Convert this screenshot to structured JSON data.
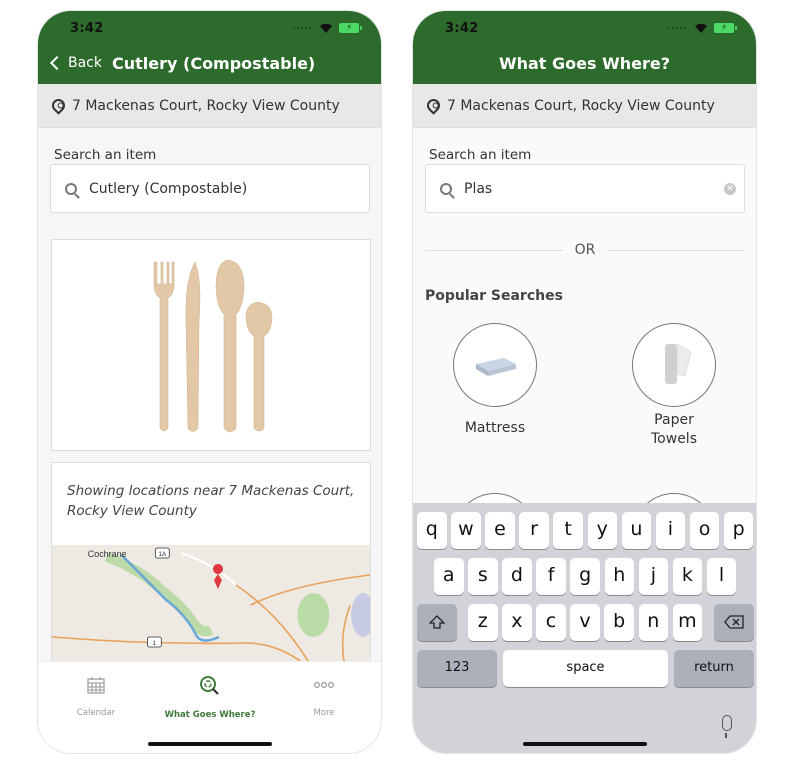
{
  "status_bar": {
    "time": "3:42"
  },
  "left_screen": {
    "nav": {
      "back_label": "Back",
      "title": "Cutlery (Compostable)"
    },
    "address": "7 Mackenas Court, Rocky View County",
    "search": {
      "label": "Search an item",
      "value": "Cutlery (Compostable)"
    },
    "item_image": "compostable-cutlery-image",
    "map_caption": "Showing locations near 7 Mackenas Court, Rocky View County",
    "map_labels": {
      "town": "Cochrane",
      "highway_1a": "1A",
      "highway_1": "1"
    },
    "tabs": [
      {
        "label": "Calendar",
        "icon": "calendar-icon",
        "active": false
      },
      {
        "label": "What Goes Where?",
        "icon": "recycle-search-icon",
        "active": true
      },
      {
        "label": "More",
        "icon": "more-icon",
        "active": false
      }
    ]
  },
  "right_screen": {
    "nav": {
      "title": "What Goes Where?"
    },
    "address": "7 Mackenas Court, Rocky View County",
    "search": {
      "label": "Search an item",
      "value": "Plas"
    },
    "divider_text": "OR",
    "popular_title": "Popular Searches",
    "popular_items": [
      {
        "label": "Mattress",
        "icon": "mattress-icon"
      },
      {
        "label": "Paper Towels",
        "icon": "paper-towels-icon"
      }
    ],
    "keyboard": {
      "row1": [
        "q",
        "w",
        "e",
        "r",
        "t",
        "y",
        "u",
        "i",
        "o",
        "p"
      ],
      "row2": [
        "a",
        "s",
        "d",
        "f",
        "g",
        "h",
        "j",
        "k",
        "l"
      ],
      "row3": [
        "z",
        "x",
        "c",
        "v",
        "b",
        "n",
        "m"
      ],
      "numbers_label": "123",
      "space_label": "space",
      "return_label": "return"
    }
  },
  "colors": {
    "brand_green": "#2d6b2c",
    "active_tab": "#3f7a3a",
    "battery": "#4cd964",
    "map_pin": "#e0383e"
  }
}
